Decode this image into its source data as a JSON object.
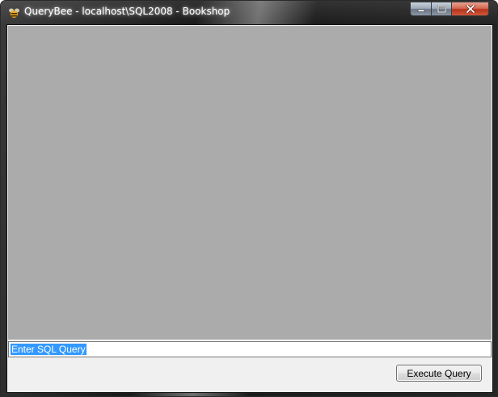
{
  "window": {
    "title": "QueryBee - localhost\\SQL2008 - Bookshop"
  },
  "controls": {
    "minimize_icon": "minimize-icon",
    "maximize_icon": "maximize-icon",
    "close_icon": "close-icon"
  },
  "query": {
    "input_value": "Enter SQL Query"
  },
  "actions": {
    "execute_label": "Execute Query"
  },
  "colors": {
    "grid_background": "#ababab",
    "selection": "#3399ff",
    "close_button": "#c8412b"
  }
}
